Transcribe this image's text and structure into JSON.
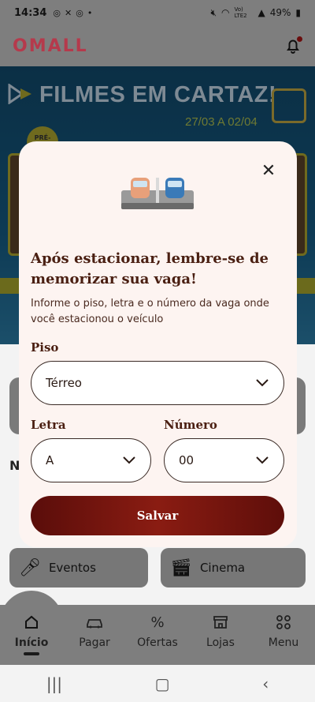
{
  "status_bar": {
    "time": "14:34",
    "battery": "49%",
    "network": "Vo) LTE2"
  },
  "header": {
    "logo": "OMALL",
    "logo_color": "#b53a4c"
  },
  "banner": {
    "title": "FILMES EM CARTAZ!",
    "dates": "27/03 A 02/04",
    "badge": "PRÉ-"
  },
  "background": {
    "section_initial": "N",
    "quick_links": [
      {
        "label": "Eventos",
        "icon": "microphone-icon"
      },
      {
        "label": "Cinema",
        "icon": "clapperboard-icon"
      }
    ]
  },
  "modal": {
    "title": "Após estacionar, lembre-se de memorizar sua vaga!",
    "subtitle": "Informe o piso, letra e o número da vaga onde você estacionou o veículo",
    "fields": {
      "piso": {
        "label": "Piso",
        "value": "Térreo"
      },
      "letra": {
        "label": "Letra",
        "value": "A"
      },
      "numero": {
        "label": "Número",
        "value": "00"
      }
    },
    "save_label": "Salvar",
    "save_color": "#6a1410"
  },
  "bottom_nav": {
    "items": [
      {
        "label": "Início",
        "icon": "home-icon",
        "active": true
      },
      {
        "label": "Pagar",
        "icon": "car-icon"
      },
      {
        "label": "Ofertas",
        "icon": "percent-icon"
      },
      {
        "label": "Lojas",
        "icon": "store-icon"
      },
      {
        "label": "Menu",
        "icon": "grid-icon"
      }
    ]
  }
}
